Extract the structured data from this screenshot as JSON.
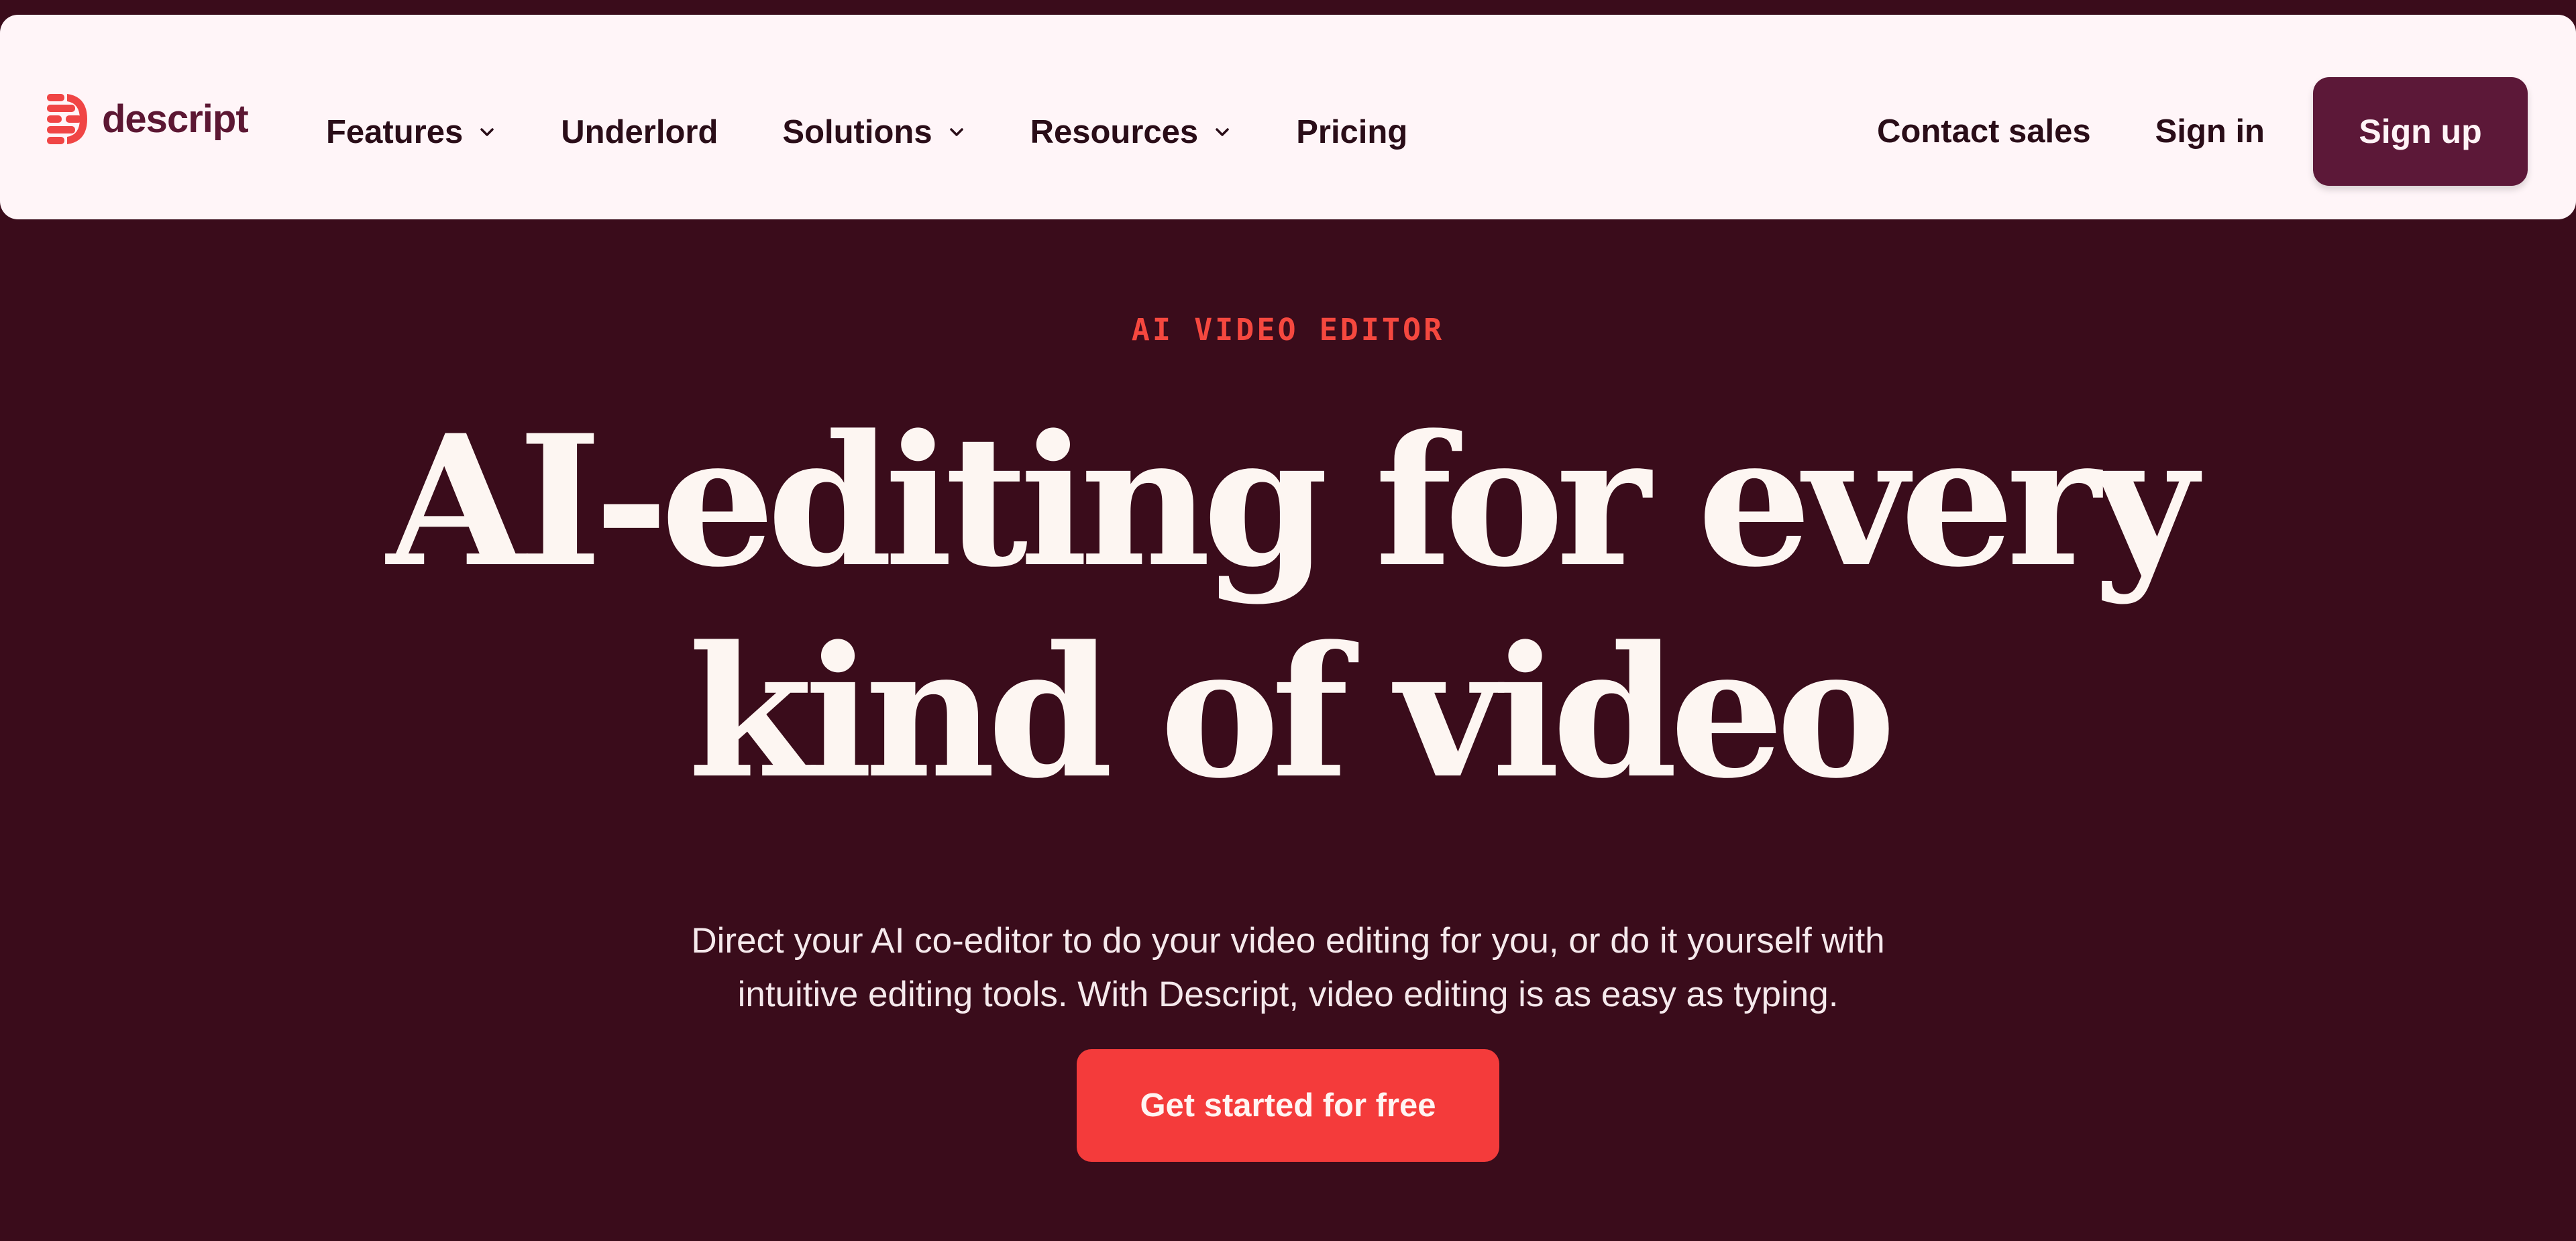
{
  "brand": {
    "name": "descript",
    "logo_icon": "descript-logo-icon",
    "color": "#5c1733",
    "icon_color": "#f04545"
  },
  "nav": {
    "items": [
      {
        "label": "Features",
        "has_dropdown": true
      },
      {
        "label": "Underlord",
        "has_dropdown": false
      },
      {
        "label": "Solutions",
        "has_dropdown": true
      },
      {
        "label": "Resources",
        "has_dropdown": true
      },
      {
        "label": "Pricing",
        "has_dropdown": false
      }
    ],
    "contact_sales": "Contact sales",
    "sign_in": "Sign in",
    "sign_up": "Sign up"
  },
  "hero": {
    "eyebrow": "AI VIDEO EDITOR",
    "headline_line1": "AI-editing for every",
    "headline_line2": "kind of video",
    "subtitle_line1": "Direct your AI co-editor to do your video editing for you, or do it yourself with",
    "subtitle_line2": "intuitive editing tools. With Descript, video editing is as easy as typing.",
    "cta": "Get started for free"
  },
  "colors": {
    "background": "#3a0c1b",
    "nav_background": "#fff5f8",
    "accent": "#f43b3b",
    "signup_button": "#5c1838",
    "headline": "#fdf6f2"
  }
}
